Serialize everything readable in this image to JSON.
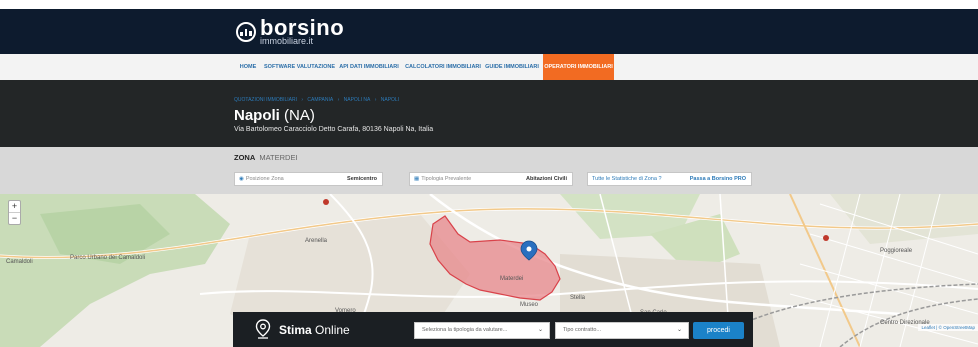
{
  "brand": {
    "name": "borsino",
    "sub": "immobiliare.it"
  },
  "nav": {
    "items": [
      {
        "label": "HOME"
      },
      {
        "label": "SOFTWARE VALUTAZIONE"
      },
      {
        "label": "API DATI IMMOBILIARI"
      },
      {
        "label": "CALCOLATORI IMMOBILIARI"
      },
      {
        "label": "GUIDE IMMOBILIARI"
      },
      {
        "label": "OPERATORI IMMOBILIARI"
      }
    ],
    "active_label": "OPERATORI IMMOBILIARI"
  },
  "breadcrumb": [
    "QUOTAZIONI IMMOBILIARI",
    "›",
    "CAMPANIA",
    "›",
    "NAPOLI NA",
    "›",
    "NAPOLI"
  ],
  "location": {
    "city": "Napoli",
    "province": "(NA)",
    "address": "Via Bartolomeo Caracciolo Detto Carafa, 80136 Napoli Na, Italia"
  },
  "zone": {
    "label": "ZONA",
    "name": "MATERDEI",
    "position_label": "Posizione Zona",
    "position_value": "Semicentro",
    "typology_label": "Tipologia Prevalente",
    "typology_value": "Abitazioni Civili",
    "stats_link": "Tutte le Statistiche di Zona ?",
    "pro_link": "Passa a Borsino PRO"
  },
  "map": {
    "zoom_in": "+",
    "zoom_out": "−",
    "labels": [
      "Camaldoli",
      "Parco Urbano dei Camaldoli",
      "Vomero",
      "Arenella",
      "Materdei",
      "Museo",
      "Stella",
      "San Carlo",
      "Poggioreale",
      "Centro Direzionale"
    ],
    "attribution": "Leaflet | © OpenStreetMap"
  },
  "stima": {
    "title_bold": "Stima",
    "title_rest": " Online",
    "select_typology": "Seleziona la tipologia da valutare...",
    "select_contract": "Tipo contratto...",
    "submit": "procedi"
  },
  "colors": {
    "header_bg": "#0d1b2e",
    "accent": "#f26b22",
    "link": "#2c7ab8",
    "zone_fill": "#e7878b",
    "marker": "#2a6fbf"
  }
}
